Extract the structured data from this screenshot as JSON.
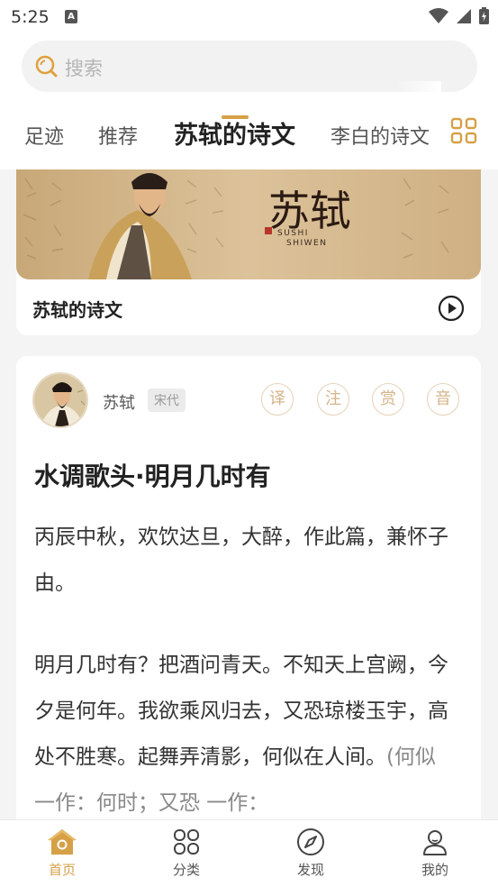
{
  "status": {
    "time": "5:25"
  },
  "search": {
    "placeholder": "搜索"
  },
  "tabs": [
    {
      "label": "足迹",
      "active": false
    },
    {
      "label": "推荐",
      "active": false
    },
    {
      "label": "苏轼的诗文",
      "active": true
    },
    {
      "label": "李白的诗文",
      "active": false
    }
  ],
  "banner": {
    "title": "苏轼的诗文",
    "art_title": "苏轼",
    "art_subtitle_1": "SUSHI",
    "art_subtitle_2": "SHIWEN"
  },
  "poem": {
    "author": "苏轼",
    "dynasty": "宋代",
    "actions": [
      "译",
      "注",
      "赏",
      "音"
    ],
    "title": "水调歌头·明月几时有",
    "preface": "丙辰中秋，欢饮达旦，大醉，作此篇，兼怀子由。",
    "body": "明月几时有？把酒问青天。不知天上宫阙，今夕是何年。我欲乘风归去，又恐琼楼玉宇，高处不胜寒。起舞弄清影，何似在人间。",
    "note": "(何似 一作：何时；又恐 一作："
  },
  "nav": [
    {
      "label": "首页",
      "icon": "home-icon",
      "active": true
    },
    {
      "label": "分类",
      "icon": "category-icon",
      "active": false
    },
    {
      "label": "发现",
      "icon": "compass-icon",
      "active": false
    },
    {
      "label": "我的",
      "icon": "user-icon",
      "active": false
    }
  ],
  "colors": {
    "accent": "#d6a046",
    "background": "#f4f4f4"
  }
}
